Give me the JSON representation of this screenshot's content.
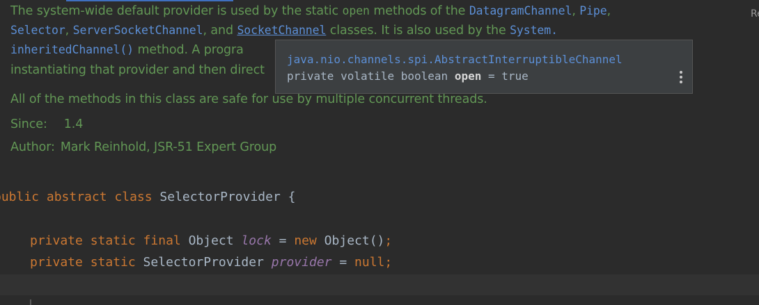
{
  "doc": {
    "p1_a": "The system-wide default provider is used by the static ",
    "p1_open": "open",
    "p1_b": " methods of the ",
    "p1_datagram": "DatagramChannel",
    "p1_comma1": ", ",
    "p1_pipe": "Pipe",
    "p1_comma2": ",",
    "p2_selector": "Selector",
    "p2_comma1": ", ",
    "p2_server": "ServerSocketChannel",
    "p2_and": ", and ",
    "p2_socket": "SocketChannel",
    "p2_rest": " classes. It is also used by the ",
    "p2_system": "System.",
    "p3_inherited": "inheritedChannel()",
    "p3_rest": " method. A progra",
    "p4_text": "instantiating that provider and then direct",
    "p5_text": "All of the methods in this class are safe for use by multiple concurrent threads.",
    "since_label": "Since:",
    "since_value": "1.4",
    "author_label": "Author:",
    "author_value": "Mark Reinhold, JSR-51 Expert Group"
  },
  "code": {
    "line1_kw": "public abstract class",
    "line1_name": " SelectorProvider {",
    "line2_kw": "private static final",
    "line2_type": " Object ",
    "line2_field": "lock",
    "line2_eq": " = ",
    "line2_new": "new",
    "line2_rest": " Object()",
    "line2_semi": ";",
    "line3_kw": "private static",
    "line3_type": " SelectorProvider ",
    "line3_field": "provider",
    "line3_eq": " = ",
    "line3_null": "null",
    "line3_semi": ";"
  },
  "popup": {
    "class_name": "java.nio.channels.spi.AbstractInterruptibleChannel",
    "decl_prefix": "private volatile boolean ",
    "decl_name": "open",
    "decl_suffix": " = true",
    "more_icon": "kebab-menu-icon"
  },
  "edge": {
    "clipped_text": "Re"
  },
  "colors": {
    "background": "#2b2b2b",
    "doc_text": "#629755",
    "link": "#5c8fd6",
    "keyword": "#cc7832",
    "field": "#9876aa",
    "plain": "#a9b7c6",
    "popup_bg": "#3c3f41"
  }
}
